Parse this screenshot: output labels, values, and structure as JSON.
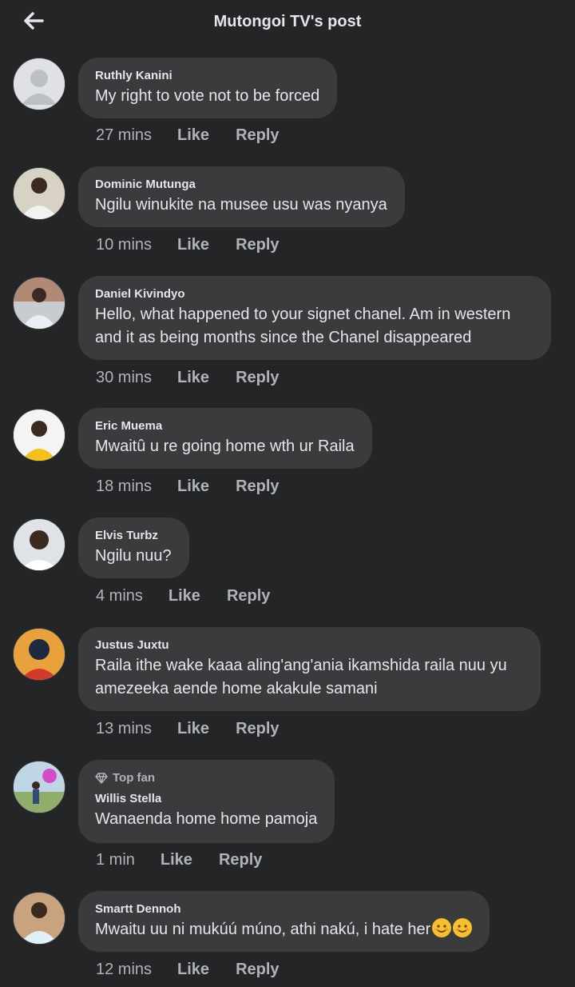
{
  "header": {
    "title": "Mutongoi TV's post",
    "back_icon": "arrow-left-icon"
  },
  "actions": {
    "like": "Like",
    "reply": "Reply"
  },
  "comments": [
    {
      "author": "Ruthly Kanini",
      "text": "My right to vote not to be forced",
      "time": "27 mins"
    },
    {
      "author": "Dominic Mutunga",
      "text": "Ngilu winukite na musee usu was nyanya",
      "time": "10 mins"
    },
    {
      "author": "Daniel Kivindyo",
      "line1": "Hello, what happened to your signet chanel. Am in western",
      "line2": "and it as being  months since the Chanel disappeared",
      "time": "30 mins"
    },
    {
      "author": "Eric Muema",
      "text": "Mwaitû u re going home wth ur Raila",
      "time": "18 mins"
    },
    {
      "author": "Elvis Turbz",
      "text": "Ngilu nuu?",
      "time": "4 mins"
    },
    {
      "author": "Justus Juxtu",
      "line1": "Raila ithe wake kaaa aling'ang'ania ikamshida raila nuu yu",
      "line2": "amezeeka aende home akakule samani",
      "time": "13 mins"
    },
    {
      "author": "Willis Stella",
      "badge": "Top fan",
      "badge_icon": "diamond-icon",
      "text": "Wanaenda home  home pamoja",
      "time": "1 min"
    },
    {
      "author": "Smartt Dennoh",
      "text": "Mwaitu uu ni mukúú múno, athi nakú, i hate her",
      "emoji": [
        "smiling-face-emoji",
        "smiling-face-emoji"
      ],
      "time": "12 mins"
    }
  ]
}
